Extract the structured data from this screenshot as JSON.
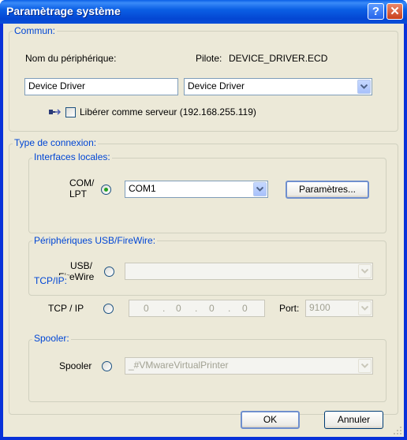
{
  "window": {
    "title": "Paramètrage système",
    "help_glyph": "?",
    "close_glyph": "✕"
  },
  "commun": {
    "legend": "Commun:",
    "device_name_label": "Nom du périphérique:",
    "driver_label": "Pilote:",
    "driver_value": "DEVICE_DRIVER.ECD",
    "device_name_value": "Device Driver",
    "driver_select_value": "Device Driver",
    "share_checkbox_label": "Libérer comme serveur (192.168.255.119)",
    "share_checked": false
  },
  "connection": {
    "legend": "Type de connexion:",
    "local": {
      "legend": "Interfaces locales:",
      "label_line1": "COM/",
      "label_line2": "LPT",
      "port_value": "COM1",
      "params_button": "Paramètres...",
      "selected": true
    },
    "usb": {
      "legend": "Périphériques USB/FireWire:",
      "label_line1": "USB/",
      "label_line2": "FireWire",
      "value": ""
    },
    "tcp": {
      "legend": "TCP/IP:",
      "label": "TCP / IP",
      "ip_octets": [
        "0",
        "0",
        "0",
        "0"
      ],
      "port_label": "Port:",
      "port_value": "9100"
    },
    "spooler": {
      "legend": "Spooler:",
      "label": "Spooler",
      "value": "_#VMwareVirtualPrinter"
    }
  },
  "buttons": {
    "ok": "OK",
    "cancel": "Annuler"
  }
}
